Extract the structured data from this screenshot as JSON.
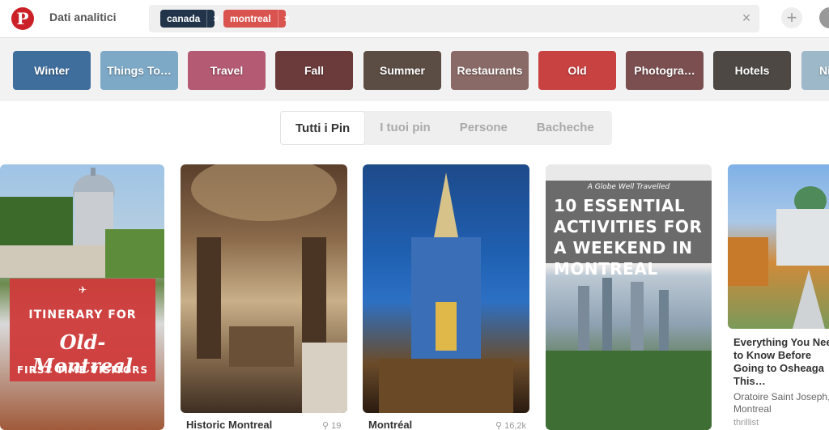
{
  "topbar": {
    "analytics_label": "Dati analitici",
    "chips": [
      {
        "label": "canada",
        "close": "×"
      },
      {
        "label": "montreal",
        "close": "×"
      }
    ],
    "clear_label": "×",
    "plus_label": "+"
  },
  "guides": [
    {
      "label": "Winter",
      "color": "#3f6e9d"
    },
    {
      "label": "Things To…",
      "color": "#7da9c7"
    },
    {
      "label": "Travel",
      "color": "#b45a72"
    },
    {
      "label": "Fall",
      "color": "#6a3b3a"
    },
    {
      "label": "Summer",
      "color": "#5b4d44"
    },
    {
      "label": "Restaurants",
      "color": "#8a6a66"
    },
    {
      "label": "Old",
      "color": "#c94242"
    },
    {
      "label": "Photogra…",
      "color": "#7b4f50"
    },
    {
      "label": "Hotels",
      "color": "#4d4843"
    },
    {
      "label": "Ni",
      "color": "#9db8c8"
    }
  ],
  "tabs": [
    "Tutti i Pin",
    "I tuoi pin",
    "Persone",
    "Bacheche"
  ],
  "pins": [
    {
      "overlay_top": "ITINERARY FOR",
      "overlay_main": "Old-Montreal",
      "overlay_bottom": "FIRST TIME VISITORS"
    },
    {
      "title": "Historic Montreal",
      "saves": "19"
    },
    {
      "title": "Montréal",
      "saves": "16,2k"
    },
    {
      "overlay_small": "A Globe Well Travelled",
      "overlay_main": "10 ESSENTIAL ACTIVITIES FOR A WEEKEND IN MONTREAL"
    },
    {
      "description": "Everything You Need to Know Before Going to Osheaga This…",
      "place": "Oratoire Saint Joseph, Montreal",
      "source": "thrillist"
    }
  ]
}
